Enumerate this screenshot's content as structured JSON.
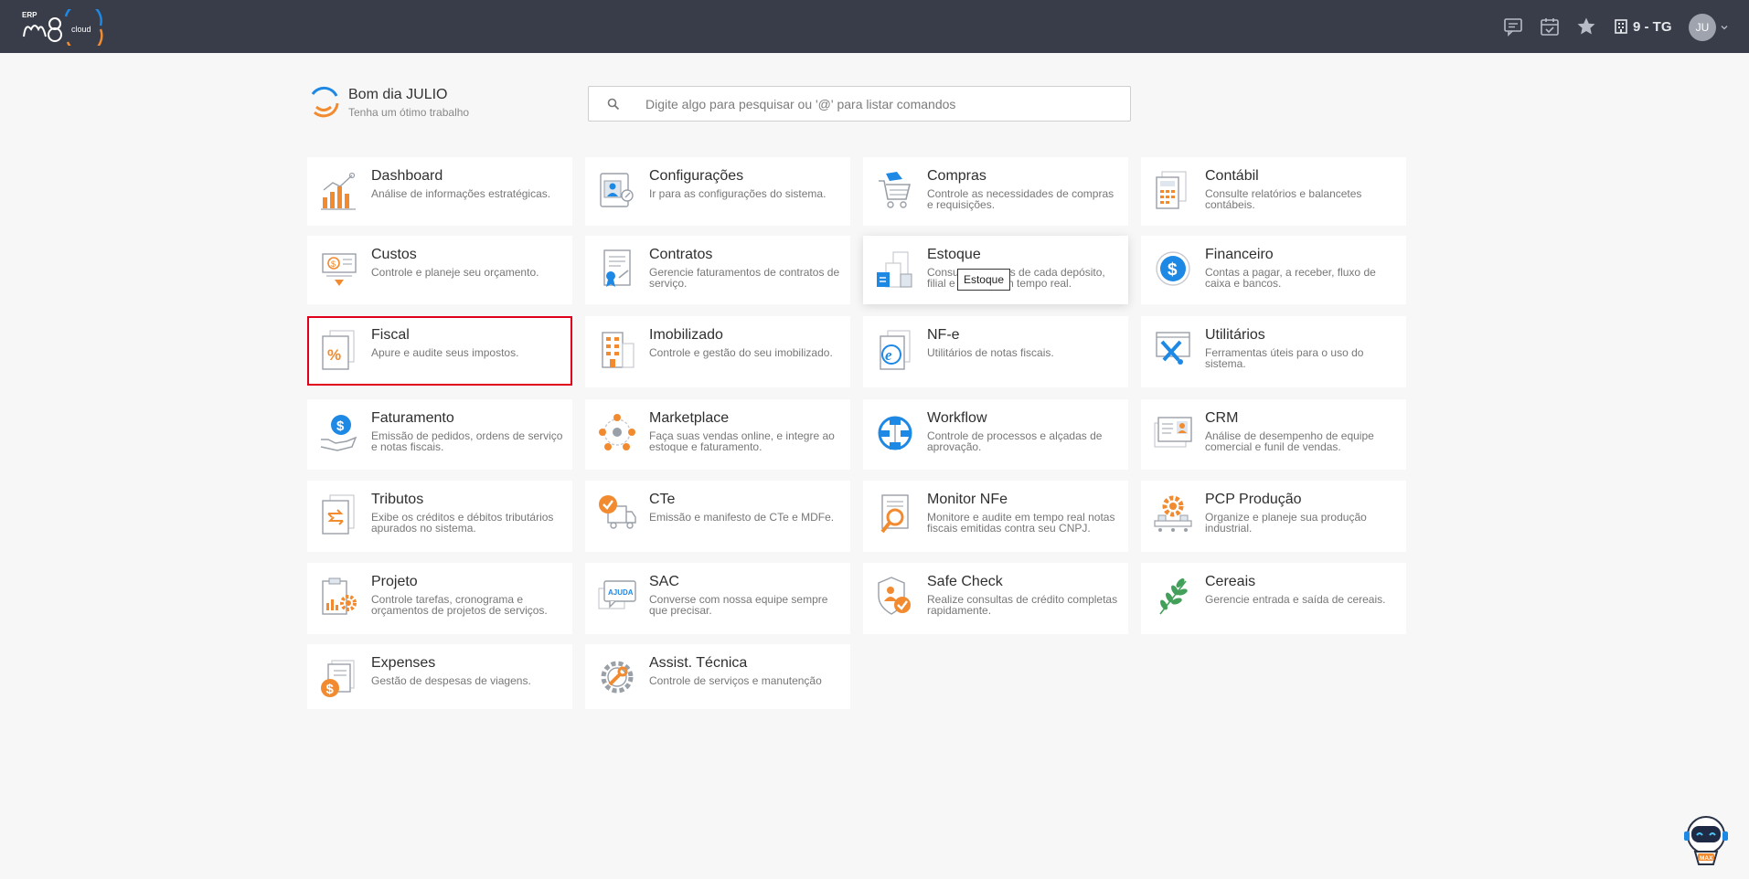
{
  "brand": {
    "erp_label": "ERP",
    "cloud_label": "cloud",
    "accent_orange": "#f28b30",
    "accent_blue": "#1e88e5"
  },
  "topbar": {
    "icons": [
      "chat-icon",
      "calendar-icon",
      "star-icon"
    ],
    "company_label": "9 - TG",
    "avatar_initials": "JU"
  },
  "greeting": {
    "title": "Bom dia JULIO",
    "subtitle": "Tenha um ótimo trabalho"
  },
  "search": {
    "placeholder": "Digite algo para pesquisar ou '@' para listar comandos",
    "value": ""
  },
  "modules": [
    {
      "title": "Dashboard",
      "desc": "Análise de informações estratégicas.",
      "icon": "bar-chart-icon"
    },
    {
      "title": "Configurações",
      "desc": "Ir para as configurações do sistema.",
      "icon": "settings-profile-icon"
    },
    {
      "title": "Compras",
      "desc": "Controle as necessidades de compras e requisições.",
      "icon": "shopping-cart-icon"
    },
    {
      "title": "Contábil",
      "desc": "Consulte relatórios e balancetes contábeis.",
      "icon": "calculator-report-icon"
    },
    {
      "title": "Custos",
      "desc": "Controle e planeje seu orçamento.",
      "icon": "cost-money-icon"
    },
    {
      "title": "Contratos",
      "desc": "Gerencie faturamentos de contratos de serviço.",
      "icon": "contract-icon"
    },
    {
      "title": "Estoque",
      "desc": "Consulte saldos de cada depósito, filial e lote em tempo real.",
      "desc_visible_parts": [
        "Consu",
        "s de cada depósito,",
        "filial e",
        "m tempo real."
      ],
      "icon": "warehouse-icon"
    },
    {
      "title": "Financeiro",
      "desc": "Contas a pagar, a receber, fluxo de caixa e bancos.",
      "icon": "dollar-circle-icon"
    },
    {
      "title": "Fiscal",
      "desc": "Apure e audite seus impostos.",
      "icon": "percent-document-icon"
    },
    {
      "title": "Imobilizado",
      "desc": "Controle e gestão do seu imobilizado.",
      "icon": "building-icon"
    },
    {
      "title": "NF-e",
      "desc": "Utilitários de notas fiscais.",
      "icon": "nfe-document-icon"
    },
    {
      "title": "Utilitários",
      "desc": "Ferramentas úteis para o uso do sistema.",
      "icon": "tools-icon"
    },
    {
      "title": "Faturamento",
      "desc": "Emissão de pedidos, ordens de serviço e notas fiscais.",
      "icon": "billing-hand-icon"
    },
    {
      "title": "Marketplace",
      "desc": "Faça suas vendas online, e integre ao estoque e faturamento.",
      "icon": "network-people-icon"
    },
    {
      "title": "Workflow",
      "desc": "Controle de processos e alçadas de aprovação.",
      "icon": "workflow-icon"
    },
    {
      "title": "CRM",
      "desc": "Análise de desempenho de equipe comercial e funil de vendas.",
      "icon": "crm-card-icon"
    },
    {
      "title": "Tributos",
      "desc": "Exibe os créditos e débitos tributários apurados no sistema.",
      "icon": "tax-transfer-icon"
    },
    {
      "title": "CTe",
      "desc": "Emissão e manifesto de CTe e MDFe.",
      "icon": "truck-check-icon"
    },
    {
      "title": "Monitor NFe",
      "desc": "Monitore e audite em tempo real notas fiscais emitidas contra seu CNPJ.",
      "icon": "magnifier-document-icon"
    },
    {
      "title": "PCP Produção",
      "desc": "Organize e planeje sua produção industrial.",
      "icon": "production-gear-icon"
    },
    {
      "title": "Projeto",
      "desc": "Controle tarefas, cronograma e orçamentos de projetos de serviços.",
      "icon": "project-clipboard-icon"
    },
    {
      "title": "SAC",
      "desc": "Converse com nossa equipe sempre que precisar.",
      "icon": "support-chat-icon",
      "icon_label": "AJUDA"
    },
    {
      "title": "Safe Check",
      "desc": "Realize consultas de crédito completas rapidamente.",
      "icon": "shield-check-icon"
    },
    {
      "title": "Cereais",
      "desc": "Gerencie entrada e saída de cereais.",
      "icon": "grain-leaf-icon"
    },
    {
      "title": "Expenses",
      "desc": "Gestão de despesas de viagens.",
      "icon": "expense-dollar-icon"
    },
    {
      "title": "Assist. Técnica",
      "desc": "Controle de serviços e manutenção",
      "icon": "wrench-gear-icon"
    }
  ],
  "active_module": "Fiscal",
  "hovered_module": "Estoque",
  "tooltip": "Estoque",
  "assistant": {
    "label": "MAX"
  }
}
